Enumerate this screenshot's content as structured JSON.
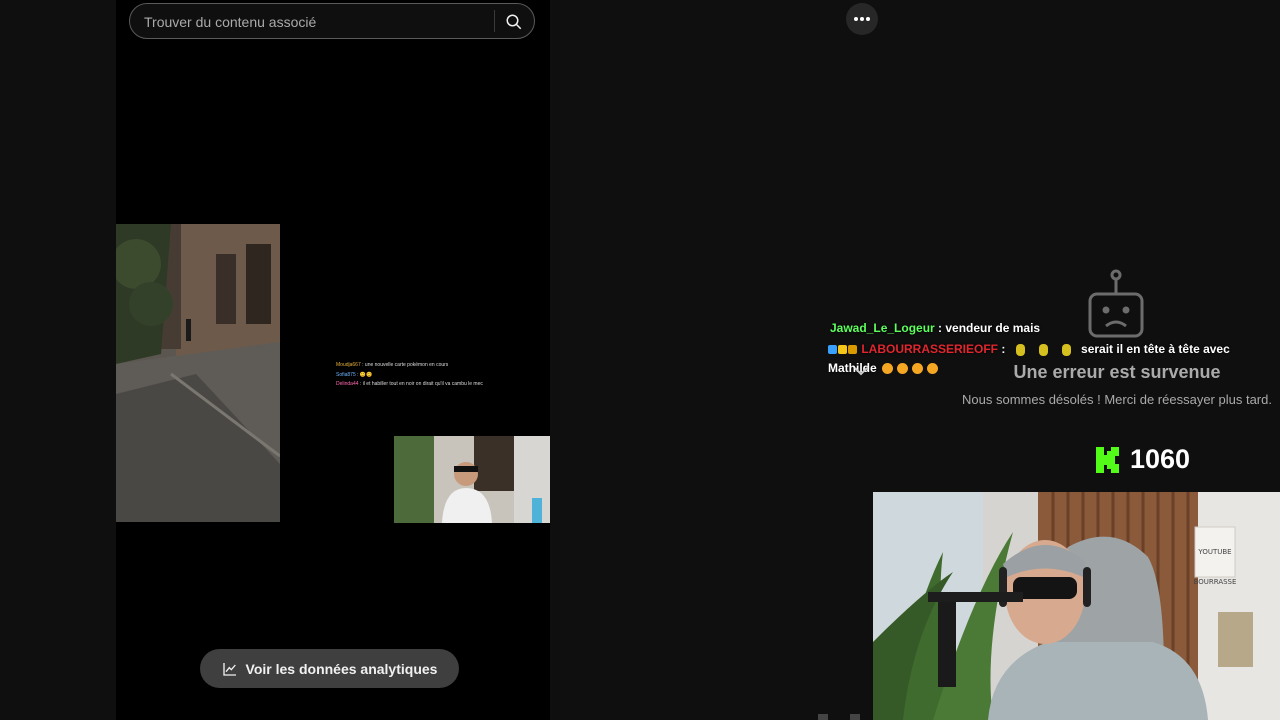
{
  "search": {
    "placeholder": "Trouver du contenu associé"
  },
  "analytics": {
    "label": "Voir les données analytiques"
  },
  "error": {
    "title": "Une erreur est survenue",
    "message": "Nous sommes désolés ! Merci de réessayer plus tard."
  },
  "chat": {
    "messages": [
      {
        "user": "Jawad_Le_Logeur",
        "separator": " : ",
        "text": "vendeur de mais"
      },
      {
        "user": "LABOURRASSERIEOFF",
        "separator": " : ",
        "text_before": "",
        "text": "serait il en tête à tête avec",
        "text_2": "Mathilde"
      }
    ]
  },
  "mini_chat": {
    "lines": [
      {
        "user": "Moudja667",
        "text": " : une nouvelle carte pokémon en cours"
      },
      {
        "user": "Sofia875",
        "text": " : 😊😊"
      },
      {
        "user": "Delinda44",
        "text": " : il et habiller tout en noir on dirait qu'il va cambu le mec"
      }
    ]
  },
  "kick": {
    "count": "1060"
  },
  "cam_sign": {
    "line1": "YOUTUBE",
    "line2": "BOURRASSE"
  },
  "colors": {
    "kick_green": "#53fc18",
    "chat_user_green": "#5dff5d",
    "chat_user_red": "#e0262e"
  },
  "icons": [
    "search-icon",
    "more-icon",
    "analytics-chart-icon",
    "robot-error-icon",
    "chevron-down-icon",
    "kick-logo-icon"
  ]
}
